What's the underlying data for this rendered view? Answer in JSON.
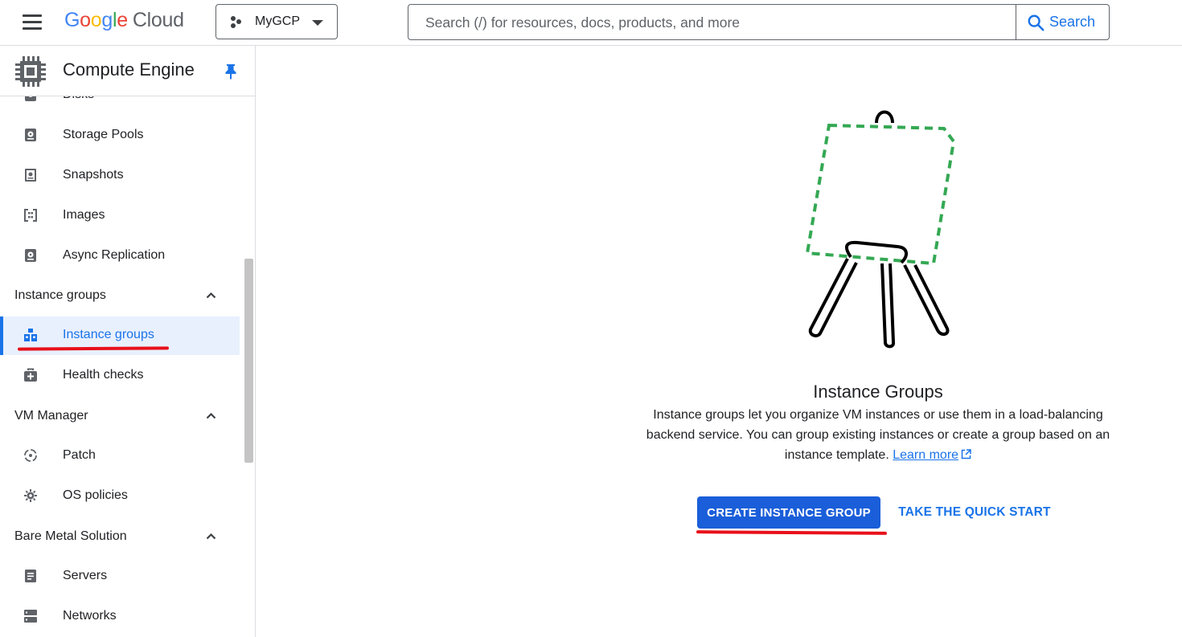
{
  "header": {
    "logo_parts": [
      "G",
      "o",
      "o",
      "g",
      "l",
      "e"
    ],
    "logo_cloud": "Cloud",
    "project_name": "MyGCP",
    "search_placeholder": "Search (/) for resources, docs, products, and more",
    "search_button": "Search"
  },
  "sidebar": {
    "title": "Compute Engine",
    "items": [
      {
        "label": "Disks",
        "icon": "disk-icon"
      },
      {
        "label": "Storage Pools",
        "icon": "storage-pool-icon"
      },
      {
        "label": "Snapshots",
        "icon": "snapshot-icon"
      },
      {
        "label": "Images",
        "icon": "image-icon"
      },
      {
        "label": "Async Replication",
        "icon": "async-replication-icon"
      }
    ],
    "sections": [
      {
        "label": "Instance groups",
        "expanded": true
      },
      {
        "label": "VM Manager",
        "expanded": true
      },
      {
        "label": "Bare Metal Solution",
        "expanded": true
      }
    ],
    "instance_group_items": [
      {
        "label": "Instance groups",
        "icon": "instance-groups-icon",
        "active": true
      },
      {
        "label": "Health checks",
        "icon": "health-checks-icon"
      }
    ],
    "vm_manager_items": [
      {
        "label": "Patch",
        "icon": "patch-icon"
      },
      {
        "label": "OS policies",
        "icon": "os-policies-icon"
      }
    ],
    "bare_metal_items": [
      {
        "label": "Servers",
        "icon": "servers-icon"
      },
      {
        "label": "Networks",
        "icon": "networks-icon"
      }
    ]
  },
  "main": {
    "heading": "Instance Groups",
    "description": "Instance groups let you organize VM instances or use them in a load-balancing backend service. You can group existing instances or create a group based on an instance template.",
    "learn_more": "Learn more",
    "primary_button": "CREATE INSTANCE GROUP",
    "secondary_button": "TAKE THE QUICK START"
  },
  "colors": {
    "accent": "#1a73e8",
    "primary_button": "#1a5ed9",
    "annotation_red": "#e8101a",
    "illustration_green": "#34a853"
  }
}
